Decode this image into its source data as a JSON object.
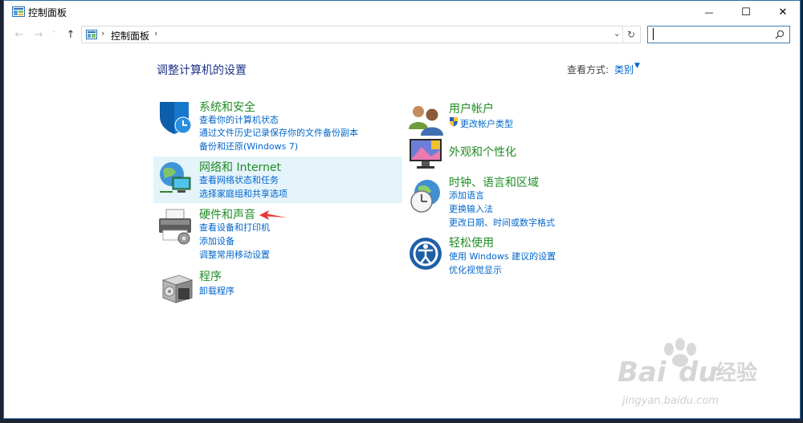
{
  "window": {
    "title": "控制面板",
    "controls": {
      "minimize": "—",
      "maximize": "☐",
      "close": "✕"
    }
  },
  "nav": {
    "back": "←",
    "forward": "→",
    "recent": "˅",
    "up": "↑"
  },
  "address": {
    "separator": "›",
    "crumb": "控制面板",
    "dropdown": "⌄",
    "refresh": "↻"
  },
  "search": {
    "placeholder": "",
    "value": ""
  },
  "heading": "调整计算机的设置",
  "view": {
    "label": "查看方式:",
    "value": "类别",
    "arrow": "▼"
  },
  "left_categories": [
    {
      "title": "系统和安全",
      "links": [
        "查看你的计算机状态",
        "通过文件历史记录保存你的文件备份副本",
        "备份和还原(Windows 7)"
      ]
    },
    {
      "title": "网络和 Internet",
      "links": [
        "查看网络状态和任务",
        "选择家庭组和共享选项"
      ]
    },
    {
      "title": "硬件和声音",
      "links": [
        "查看设备和打印机",
        "添加设备",
        "调整常用移动设置"
      ]
    },
    {
      "title": "程序",
      "links": [
        "卸载程序"
      ]
    }
  ],
  "right_categories": [
    {
      "title": "用户帐户",
      "links": [
        "更改帐户类型"
      ]
    },
    {
      "title": "外观和个性化",
      "links": []
    },
    {
      "title": "时钟、语言和区域",
      "links": [
        "添加语言",
        "更换输入法",
        "更改日期、时间或数字格式"
      ]
    },
    {
      "title": "轻松使用",
      "links": [
        "使用 Windows 建议的设置",
        "优化视觉显示"
      ]
    }
  ],
  "colors": {
    "category_title": "#1f8c24",
    "link": "#0066cc",
    "heading": "#1e3287",
    "highlight": "#e5f3fb",
    "annotation_arrow": "#e53935"
  },
  "icons": {
    "system_security": "shield-icon",
    "network": "network-globe-icon",
    "hardware": "printer-icon",
    "programs": "programs-box-icon",
    "user_accounts": "users-icon",
    "appearance": "monitor-icon",
    "clock_region": "clock-globe-icon",
    "ease_of_access": "ease-of-access-icon"
  }
}
